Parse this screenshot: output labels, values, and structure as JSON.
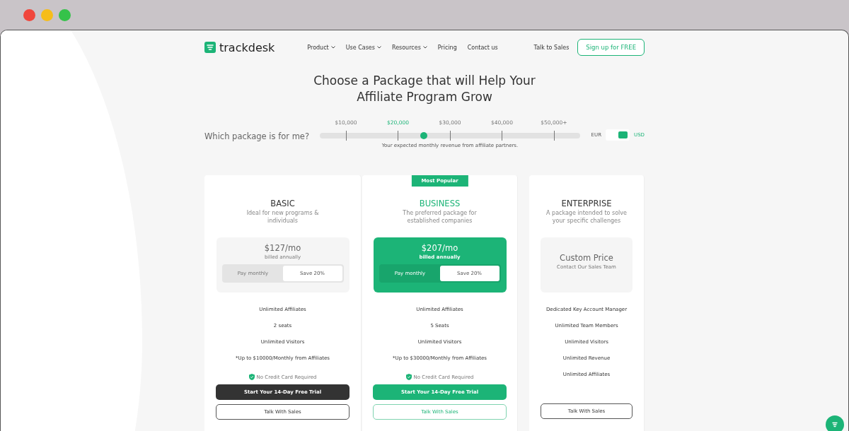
{
  "nav": {
    "logo": "trackdesk",
    "links": [
      {
        "label": "Product",
        "dropdown": true
      },
      {
        "label": "Use Cases",
        "dropdown": true
      },
      {
        "label": "Resources",
        "dropdown": true
      },
      {
        "label": "Pricing",
        "dropdown": false
      },
      {
        "label": "Contact us",
        "dropdown": false
      }
    ],
    "talk": "Talk to Sales",
    "signup": "Sign up for FREE"
  },
  "title": "Choose a Package that will Help Your Affiliate Program Grow",
  "selector": {
    "question": "Which package is for me?",
    "ticks": [
      {
        "label": "$10,000",
        "selected": false
      },
      {
        "label": "$20,000",
        "selected": true
      },
      {
        "label": "$30,000",
        "selected": false
      },
      {
        "label": "$40,000",
        "selected": false
      },
      {
        "label": "$50,000+",
        "selected": false
      }
    ],
    "level": 0.4,
    "hint": "Your expected monthly revenue from affiliate partners.",
    "currencies": [
      {
        "label": "EUR",
        "selected": false
      },
      {
        "label": "USD",
        "selected": true
      }
    ]
  },
  "plans": [
    {
      "name": "BASIC",
      "featured": false,
      "subtitle": "Ideal for new programs & individuals",
      "price": "$127/mo",
      "price_note": "billed annually",
      "billing": [
        {
          "label": "Pay monthly",
          "selected": false
        },
        {
          "label": "Save 20%",
          "selected": true
        }
      ],
      "features": [
        "Unlimited Affiliates",
        "2 seats",
        "Unlimited Visitors",
        "*Up to $10000/Monthly from Affiliates"
      ],
      "no_card": "No Credit Card Required",
      "trial": "Start Your 14-Day Free Trial",
      "sales": "Talk With Sales"
    },
    {
      "name": "BUSINESS",
      "featured": true,
      "badge": "Most Popular",
      "subtitle": "The preferred package for established companies",
      "price": "$207/mo",
      "price_note": "billed annually",
      "billing": [
        {
          "label": "Pay monthly",
          "selected": false
        },
        {
          "label": "Save 20%",
          "selected": true
        }
      ],
      "features": [
        "Unlimited Affiliates",
        "5 Seats",
        "Unlimited Visitors",
        "*Up to $30000/Monthly from Affiliates"
      ],
      "no_card": "No Credit Card Required",
      "trial": "Start Your 14-Day Free Trial",
      "sales": "Talk With Sales"
    },
    {
      "name": "ENTERPRISE",
      "featured": false,
      "subtitle": "A package intended to solve your specific challenges",
      "price": "Custom Price",
      "price_note": "Contact Our Sales Team",
      "features": [
        "Dedicated Key Account Manager",
        "Unlimited Team Members",
        "Unlimited Visitors",
        "Unlimited Revenue",
        "Unlimited Affiliates"
      ],
      "sales": "Talk With Sales"
    }
  ]
}
